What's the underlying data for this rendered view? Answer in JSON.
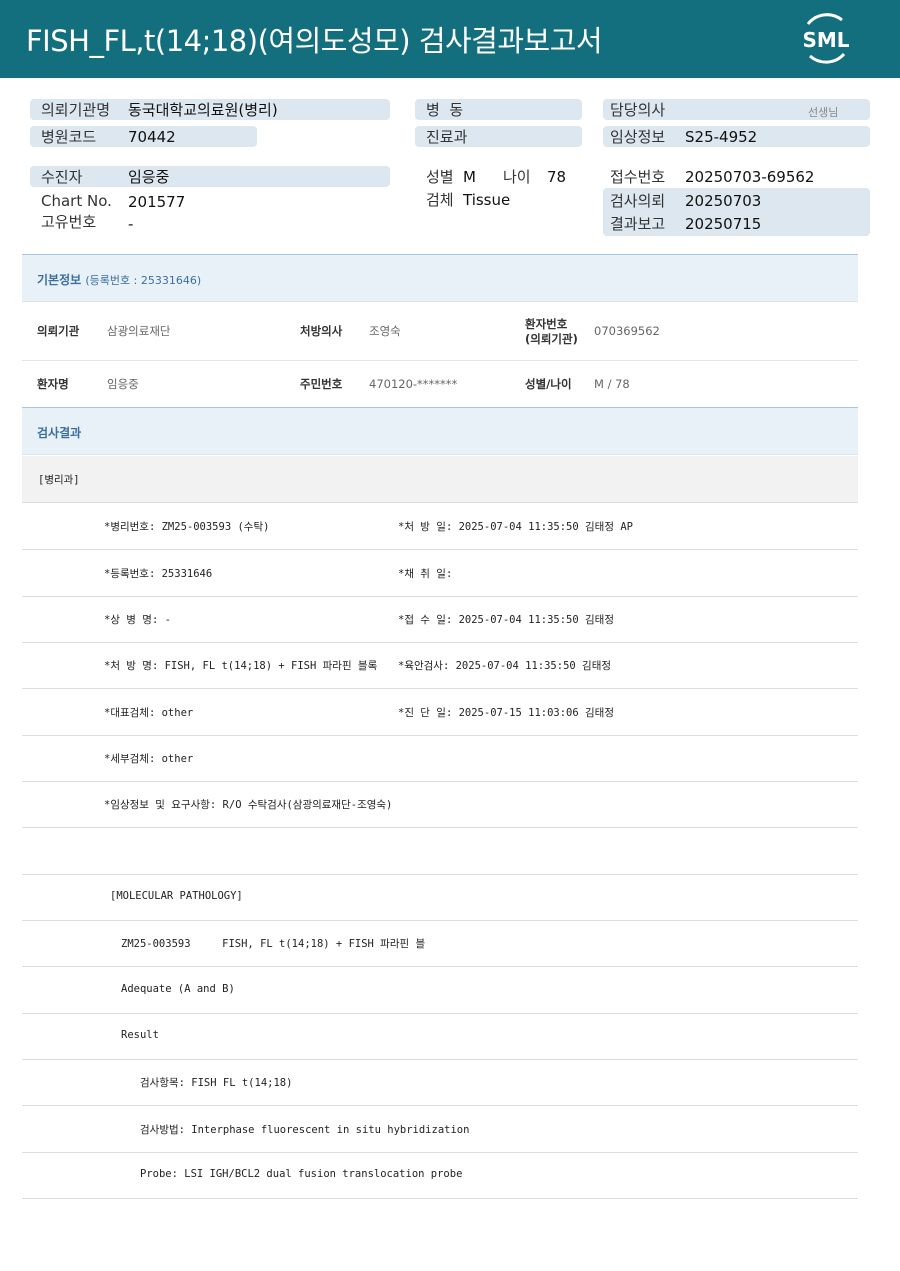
{
  "header": {
    "title": "FISH_FL,t(14;18)(여의도성모) 검사결과보고서",
    "logo_text": "SML"
  },
  "summary": {
    "referring_institution": {
      "label": "의뢰기관명",
      "value": "동국대학교의료원(병리)"
    },
    "hospital_code": {
      "label": "병원코드",
      "value": "70442"
    },
    "ward": {
      "label": "병  동",
      "value": ""
    },
    "department": {
      "label": "진료과",
      "value": ""
    },
    "doctor": {
      "label": "담당의사",
      "value": "",
      "suffix": "선생님"
    },
    "clinical_info": {
      "label": "임상정보",
      "value": "S25-4952"
    },
    "patient": {
      "label": "수진자",
      "value": "임응중"
    },
    "chart_no": {
      "label": "Chart No.",
      "value": "201577"
    },
    "unique_no": {
      "label": "고유번호",
      "value": "-"
    },
    "sex": {
      "label": "성별",
      "value": "M"
    },
    "age": {
      "label": "나이",
      "value": "78"
    },
    "specimen": {
      "label": "검체",
      "value": "Tissue"
    },
    "receipt_no": {
      "label": "접수번호",
      "value": "20250703-69562"
    },
    "request_date": {
      "label": "검사의뢰",
      "value": "20250703"
    },
    "report_date": {
      "label": "결과보고",
      "value": "20250715"
    }
  },
  "basic_info": {
    "heading": "기본정보",
    "reg_note": "(등록번호 : 25331646)",
    "rows": [
      [
        {
          "key": "의뢰기관",
          "value": "삼광의료재단"
        },
        {
          "key": "처방의사",
          "value": "조영숙"
        },
        {
          "key_line1": "환자번호",
          "key_line2": "(의뢰기관)",
          "value": "070369562"
        }
      ],
      [
        {
          "key": "환자명",
          "value": "임응중"
        },
        {
          "key": "주민번호",
          "value": "470120-*******"
        },
        {
          "key": "성별/나이",
          "value": "M / 78"
        }
      ]
    ]
  },
  "results": {
    "heading": "검사결과",
    "section_label": "[병리과]",
    "rows": [
      {
        "left": "*병리번호: ZM25-003593 (수탁)",
        "right": "*처 방 일: 2025-07-04 11:35:50  김태정 AP"
      },
      {
        "left": "*등록번호: 25331646",
        "right": "*채 취 일:"
      },
      {
        "left": "*상 병 명: -",
        "right": "*접 수 일: 2025-07-04 11:35:50  김태정"
      },
      {
        "left": "*처 방 명: FISH, FL t(14;18) + FISH 파라핀 블록",
        "right": "*육안검사: 2025-07-04 11:35:50  김태정"
      },
      {
        "left": "*대표검체: other",
        "right": "*진 단 일: 2025-07-15 11:03:06  김태정"
      },
      {
        "left": "*세부검체: other",
        "right": ""
      },
      {
        "left": "*임상정보 및 요구사항: R/O 수탁검사(삼광의료재단-조영숙)",
        "right": ""
      },
      {
        "left": "",
        "right": ""
      },
      {
        "left": "[MOLECULAR PATHOLOGY]",
        "right": ""
      },
      {
        "left": "ZM25-003593     FISH, FL t(14;18) + FISH 파라핀 블",
        "right": ""
      },
      {
        "left": "Adequate (A and B)",
        "right": ""
      },
      {
        "left": "Result",
        "right": ""
      },
      {
        "left": "검사항목: FISH FL t(14;18)",
        "right": ""
      },
      {
        "left": "검사방법: Interphase fluorescent in situ hybridization",
        "right": ""
      },
      {
        "left": "Probe: LSI IGH/BCL2 dual fusion translocation probe",
        "right": ""
      }
    ]
  }
}
